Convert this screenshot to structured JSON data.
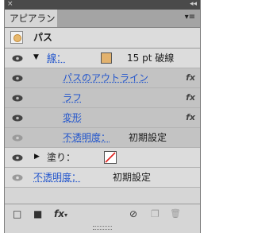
{
  "window": {
    "collapse_glyph": "◂◂",
    "close_glyph": "×",
    "tab_label": "アピアランス",
    "menu_glyph": "▾≡"
  },
  "rows": {
    "path": {
      "label": "パス",
      "thumb_color": "#e8b86c"
    },
    "stroke": {
      "label": "線：",
      "swatch_color": "#e2b26e",
      "value": "15 pt 破線"
    },
    "effect_outline": {
      "label": "パスのアウトライン",
      "fx": "fx"
    },
    "effect_rough": {
      "label": "ラフ",
      "fx": "fx"
    },
    "effect_transform": {
      "label": "変形",
      "fx": "fx"
    },
    "stroke_opacity": {
      "label": "不透明度：",
      "value": "初期設定"
    },
    "fill": {
      "label": "塗り：",
      "swatch": "none"
    },
    "opacity": {
      "label": "不透明度：",
      "value": "初期設定"
    }
  },
  "toolbar": {
    "add_stroke_icon": "□",
    "add_fill_icon": "■",
    "fx_label": "fx",
    "clear_icon": "⊘",
    "duplicate_icon": "❐",
    "delete_icon": "🗑"
  }
}
